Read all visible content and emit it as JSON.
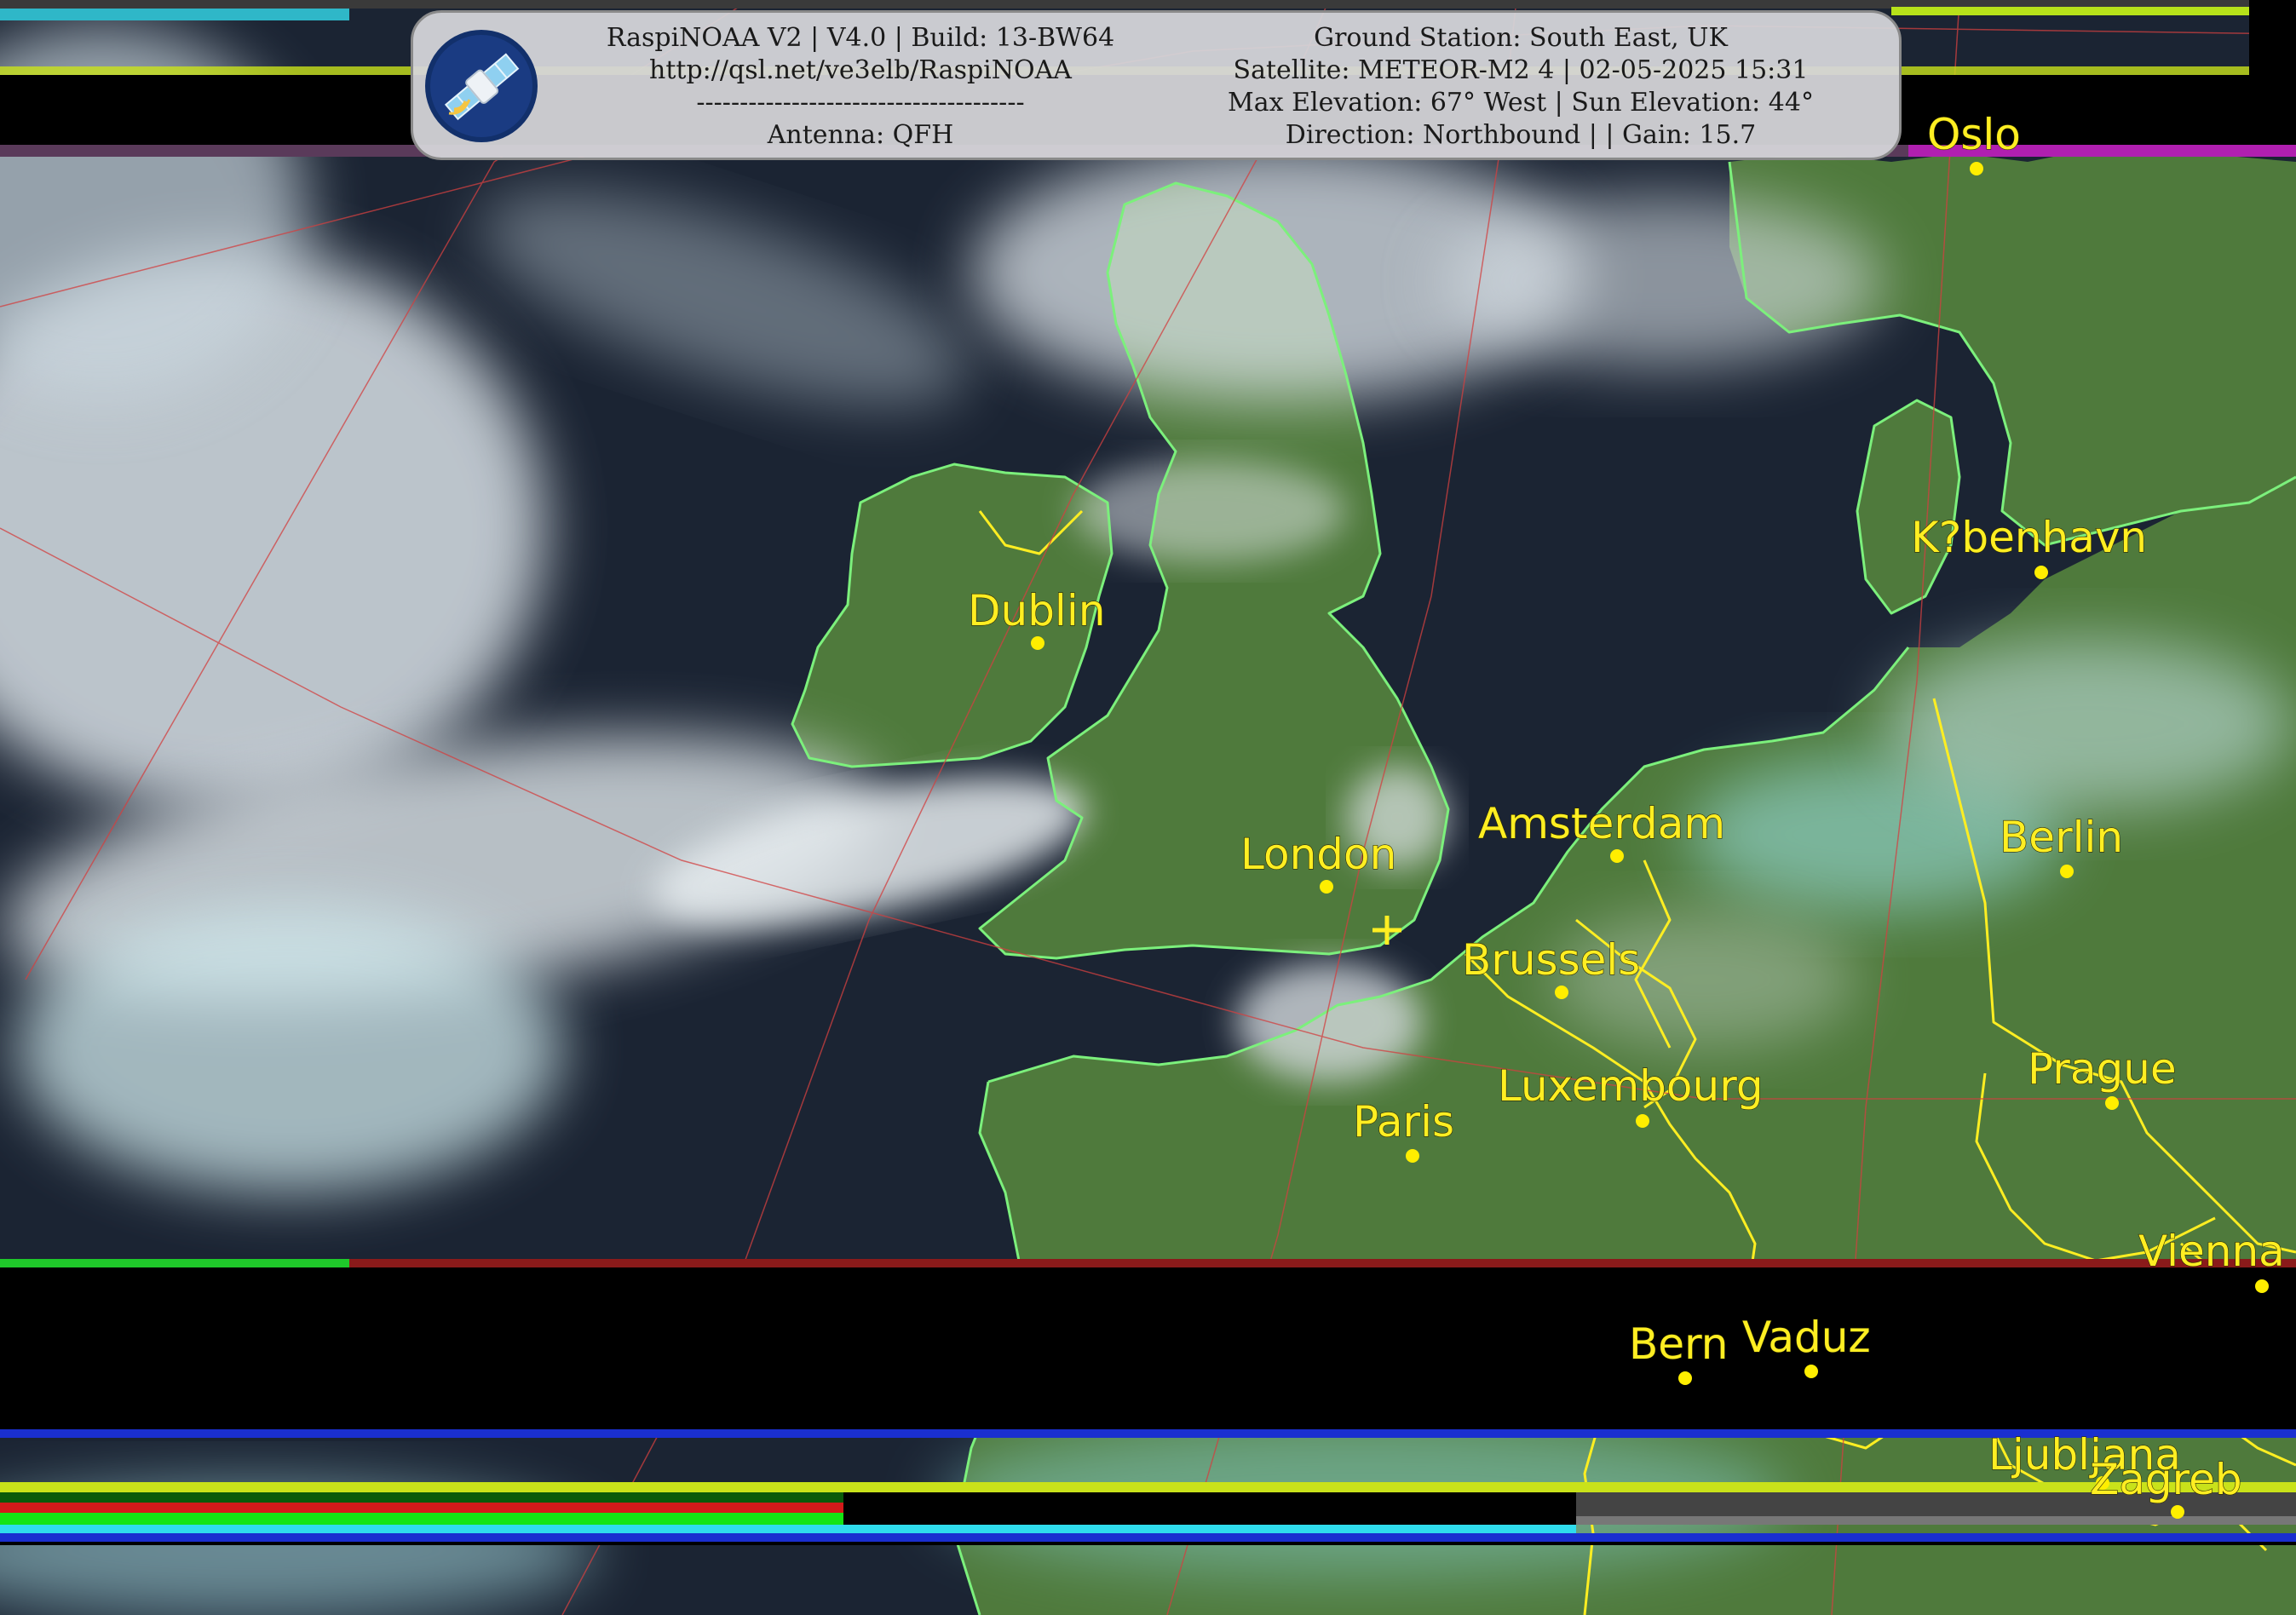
{
  "banner": {
    "left_lines": [
      "RaspiNOAA V2 | V4.0 | Build: 13-BW64",
      "http://qsl.net/ve3elb/RaspiNOAA",
      "--------------------------------------",
      "Antenna: QFH"
    ],
    "right_lines": [
      "Ground Station: South East, UK",
      "Satellite: METEOR-M2 4 | 02-05-2025 15:31",
      "Max Elevation: 67° West | Sun Elevation: 44°",
      "Direction: Northbound | | Gain: 15.7"
    ],
    "logo_icon": "satellite-icon"
  },
  "cities": [
    {
      "id": "oslo",
      "name": "Oslo"
    },
    {
      "id": "kobenhavn",
      "name": "K?benhavn"
    },
    {
      "id": "dublin",
      "name": "Dublin"
    },
    {
      "id": "amsterdam",
      "name": "Amsterdam"
    },
    {
      "id": "berlin",
      "name": "Berlin"
    },
    {
      "id": "london",
      "name": "London"
    },
    {
      "id": "brussels",
      "name": "Brussels"
    },
    {
      "id": "luxembourg",
      "name": "Luxembourg"
    },
    {
      "id": "prague",
      "name": "Prague"
    },
    {
      "id": "paris",
      "name": "Paris"
    },
    {
      "id": "vienna",
      "name": "Vienna"
    },
    {
      "id": "bern",
      "name": "Bern"
    },
    {
      "id": "vaduz",
      "name": "Vaduz"
    },
    {
      "id": "ljubljana",
      "name": "Ljubljana"
    },
    {
      "id": "zagreb",
      "name": "Zagreb"
    }
  ],
  "ground_station_marker_icon": "crosshair-plus-icon",
  "colors": {
    "ocean": "#1b2433",
    "land": "#4f7a3c",
    "cloud": "#dfe6ea",
    "cloud_cyan": "#8fe6ea",
    "coastline": "#7cf07c",
    "border": "#ffee22",
    "grid": "#d24040",
    "label": "#ffee22"
  }
}
